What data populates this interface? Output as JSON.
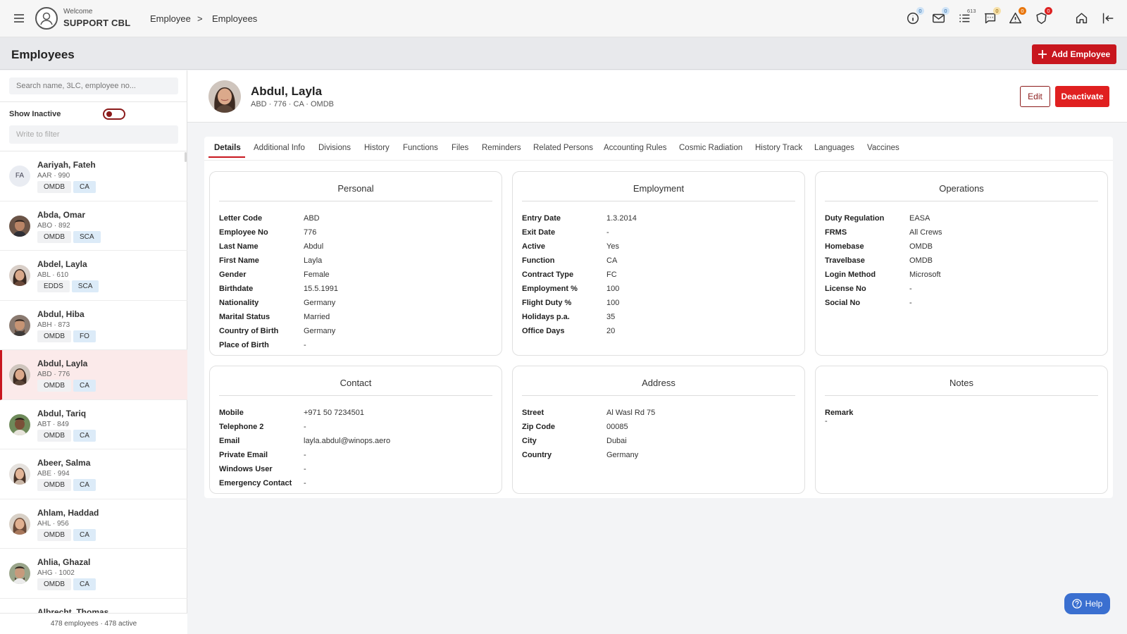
{
  "app": {
    "welcome": "Welcome",
    "user": "SUPPORT CBL",
    "breadcrumb": [
      "Employee",
      ">",
      "Employees"
    ]
  },
  "topbar_icons": [
    {
      "icon": "info-icon",
      "badge": "0"
    },
    {
      "icon": "mail-icon",
      "badge": "0"
    },
    {
      "icon": "list-icon",
      "badge": "613"
    },
    {
      "icon": "chat-icon",
      "badge": "0"
    },
    {
      "icon": "warning-icon",
      "badge": "0"
    },
    {
      "icon": "shield-icon",
      "badge": "0"
    },
    {
      "icon": "home-icon",
      "badge": ""
    },
    {
      "icon": "logout-icon",
      "badge": ""
    }
  ],
  "page": {
    "title": "Employees",
    "add_button": "Add Employee"
  },
  "sidebar": {
    "search_placeholder": "Search name, 3LC, employee no...",
    "show_inactive": "Show Inactive",
    "filter_placeholder": "Write to filter",
    "footer": "478 employees · 478 active",
    "employees": [
      {
        "name": "Aariyah, Fateh",
        "sub": "AAR · 990",
        "tags": [
          "OMDB",
          "CA"
        ],
        "initials": "FA"
      },
      {
        "name": "Abda, Omar",
        "sub": "ABO · 892",
        "tags": [
          "OMDB",
          "SCA"
        ],
        "initials": ""
      },
      {
        "name": "Abdel, Layla",
        "sub": "ABL · 610",
        "tags": [
          "EDDS",
          "SCA"
        ],
        "initials": ""
      },
      {
        "name": "Abdul, Hiba",
        "sub": "ABH · 873",
        "tags": [
          "OMDB",
          "FO"
        ],
        "initials": ""
      },
      {
        "name": "Abdul, Layla",
        "sub": "ABD · 776",
        "tags": [
          "OMDB",
          "CA"
        ],
        "initials": "",
        "active": true
      },
      {
        "name": "Abdul, Tariq",
        "sub": "ABT · 849",
        "tags": [
          "OMDB",
          "CA"
        ],
        "initials": ""
      },
      {
        "name": "Abeer, Salma",
        "sub": "ABE · 994",
        "tags": [
          "OMDB",
          "CA"
        ],
        "initials": ""
      },
      {
        "name": "Ahlam, Haddad",
        "sub": "AHL · 956",
        "tags": [
          "OMDB",
          "CA"
        ],
        "initials": ""
      },
      {
        "name": "Ahlia, Ghazal",
        "sub": "AHG · 1002",
        "tags": [
          "OMDB",
          "CA"
        ],
        "initials": ""
      },
      {
        "name": "Albrecht, Thomas",
        "sub": "",
        "tags": [],
        "initials": ""
      }
    ]
  },
  "employee": {
    "name": "Abdul, Layla",
    "sub": "ABD · 776 · CA · OMDB",
    "edit": "Edit",
    "deactivate": "Deactivate"
  },
  "tabs": [
    "Details",
    "Additional Info",
    "Divisions",
    "History",
    "Functions",
    "Files",
    "Reminders",
    "Related Persons",
    "Accounting Rules",
    "Cosmic Radiation",
    "History Track",
    "Languages",
    "Vaccines"
  ],
  "cards": {
    "personal": {
      "title": "Personal",
      "fields": [
        [
          "Letter Code",
          "ABD"
        ],
        [
          "Employee No",
          "776"
        ],
        [
          "Last Name",
          "Abdul"
        ],
        [
          "First Name",
          "Layla"
        ],
        [
          "Gender",
          "Female"
        ],
        [
          "Birthdate",
          "15.5.1991"
        ],
        [
          "Nationality",
          "Germany"
        ],
        [
          "Marital Status",
          "Married"
        ],
        [
          "Country of Birth",
          "Germany"
        ],
        [
          "Place of Birth",
          "-"
        ]
      ]
    },
    "employment": {
      "title": "Employment",
      "fields": [
        [
          "Entry Date",
          "1.3.2014"
        ],
        [
          "Exit Date",
          "-"
        ],
        [
          "Active",
          "Yes"
        ],
        [
          "Function",
          "CA"
        ],
        [
          "Contract Type",
          "FC"
        ],
        [
          "Employment %",
          "100"
        ],
        [
          "Flight Duty %",
          "100"
        ],
        [
          "Holidays p.a.",
          "35"
        ],
        [
          "Office Days",
          "20"
        ]
      ]
    },
    "operations": {
      "title": "Operations",
      "fields": [
        [
          "Duty Regulation",
          "EASA"
        ],
        [
          "FRMS",
          "All Crews"
        ],
        [
          "Homebase",
          "OMDB"
        ],
        [
          "Travelbase",
          "OMDB"
        ],
        [
          "Login Method",
          "Microsoft"
        ],
        [
          "License No",
          "-"
        ],
        [
          "Social No",
          "-"
        ]
      ]
    },
    "contact": {
      "title": "Contact",
      "fields": [
        [
          "Mobile",
          "+971 50 7234501"
        ],
        [
          "Telephone 2",
          "-"
        ],
        [
          "Email",
          "layla.abdul@winops.aero"
        ],
        [
          "Private Email",
          "-"
        ],
        [
          "Windows User",
          "-"
        ],
        [
          "Emergency Contact",
          "-"
        ]
      ]
    },
    "address": {
      "title": "Address",
      "fields": [
        [
          "Street",
          "Al Wasl Rd 75"
        ],
        [
          "Zip Code",
          "00085"
        ],
        [
          "City",
          "Dubai"
        ],
        [
          "Country",
          "Germany"
        ]
      ]
    },
    "notes": {
      "title": "Notes",
      "remark_label": "Remark",
      "remark_value": "-"
    }
  },
  "help": "Help",
  "colors": {
    "accent": "#c8161e",
    "help": "#3a6fd0"
  }
}
